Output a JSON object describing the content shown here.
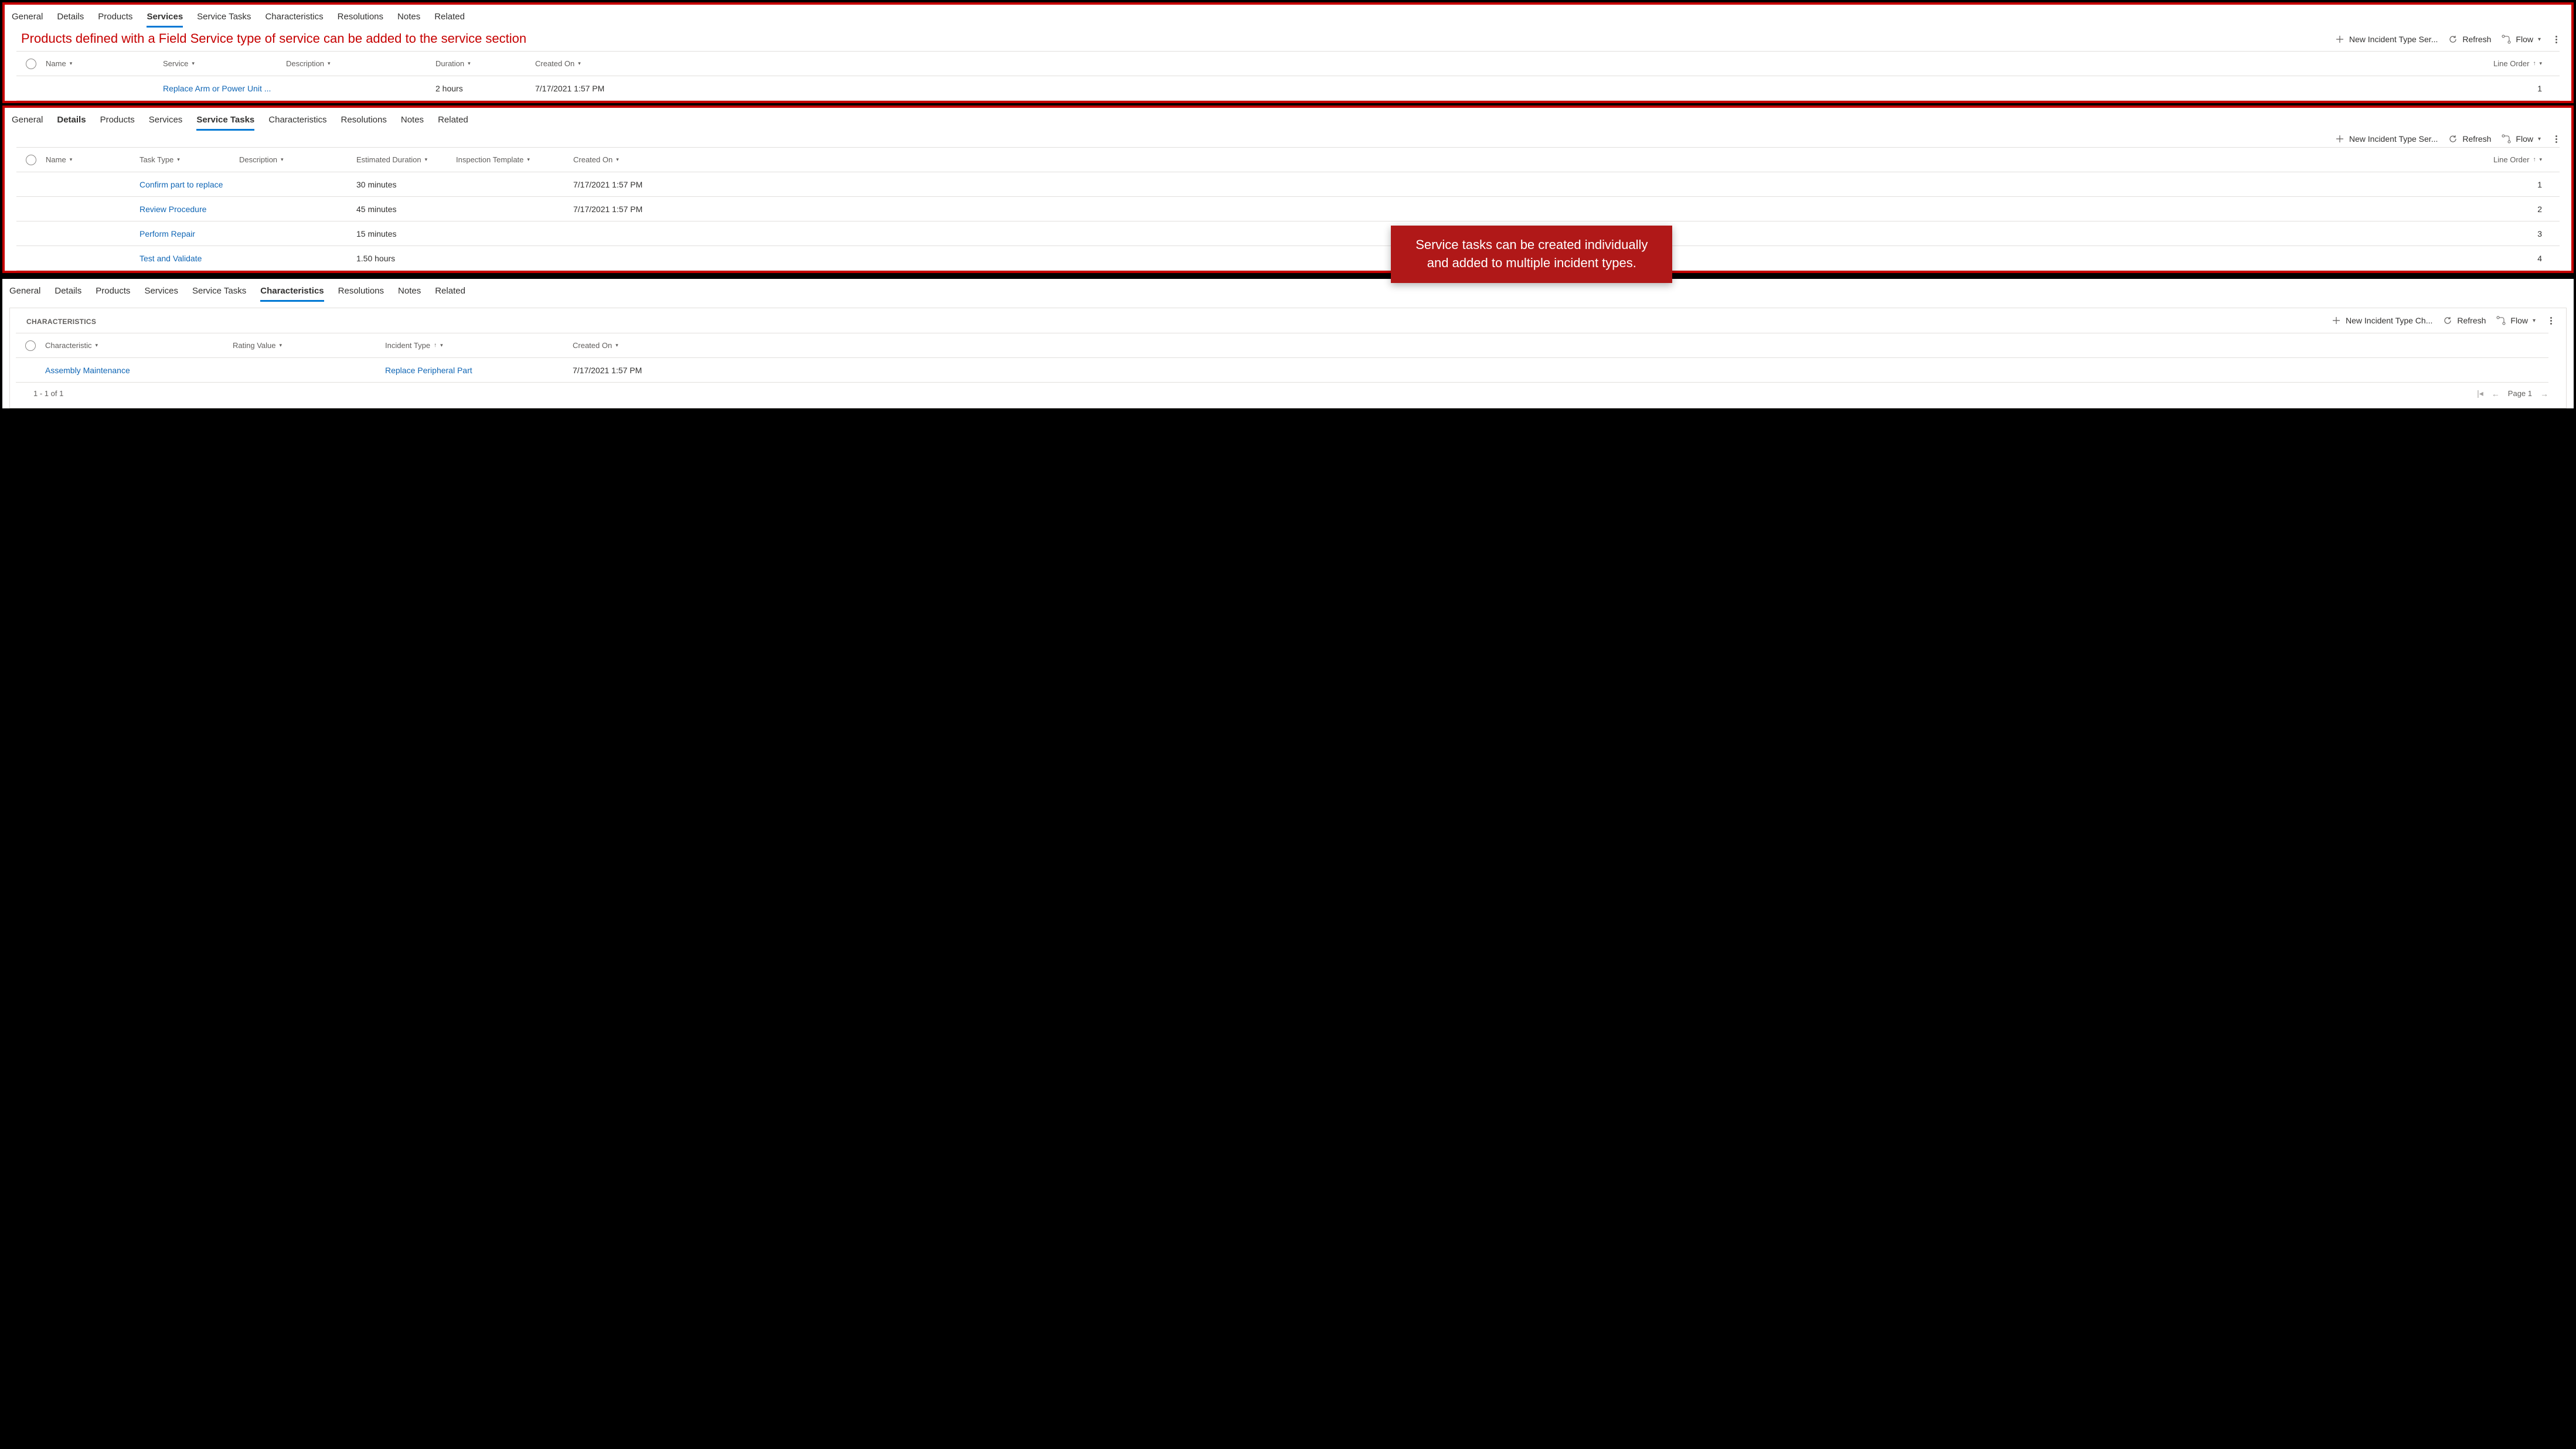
{
  "tabs": [
    "General",
    "Details",
    "Products",
    "Services",
    "Service Tasks",
    "Characteristics",
    "Resolutions",
    "Notes",
    "Related"
  ],
  "panel1": {
    "activeTab": "Services",
    "caption": "Products defined with a Field Service type of service can be added to the service section",
    "toolbar": {
      "newLabel": "New Incident Type Ser...",
      "refresh": "Refresh",
      "flow": "Flow"
    },
    "columns": {
      "name": "Name",
      "service": "Service",
      "description": "Description",
      "duration": "Duration",
      "createdOn": "Created On",
      "lineOrder": "Line Order"
    },
    "rows": [
      {
        "name": "",
        "service": "Replace Arm or Power Unit ...",
        "description": "",
        "duration": "2 hours",
        "createdOn": "7/17/2021 1:57 PM",
        "lineOrder": "1"
      }
    ]
  },
  "panel2": {
    "activeTab": "Service Tasks",
    "boldTab": "Details",
    "toolbar": {
      "newLabel": "New Incident Type Ser...",
      "refresh": "Refresh",
      "flow": "Flow"
    },
    "columns": {
      "name": "Name",
      "taskType": "Task Type",
      "description": "Description",
      "estDuration": "Estimated Duration",
      "inspection": "Inspection Template",
      "createdOn": "Created On",
      "lineOrder": "Line Order"
    },
    "rows": [
      {
        "taskType": "Confirm part to replace",
        "estDuration": "30 minutes",
        "createdOn": "7/17/2021 1:57 PM",
        "lineOrder": "1"
      },
      {
        "taskType": "Review Procedure",
        "estDuration": "45 minutes",
        "createdOn": "7/17/2021 1:57 PM",
        "lineOrder": "2"
      },
      {
        "taskType": "Perform Repair",
        "estDuration": "15 minutes",
        "createdOn": "",
        "lineOrder": "3"
      },
      {
        "taskType": "Test and Validate",
        "estDuration": "1.50 hours",
        "createdOn": "",
        "lineOrder": "4"
      }
    ],
    "callout": "Service tasks can be created individually and added to multiple incident types."
  },
  "panel3": {
    "activeTab": "Characteristics",
    "sectionLabel": "CHARACTERISTICS",
    "toolbar": {
      "newLabel": "New Incident Type Ch...",
      "refresh": "Refresh",
      "flow": "Flow"
    },
    "columns": {
      "characteristic": "Characteristic",
      "rating": "Rating Value",
      "incidentType": "Incident Type",
      "createdOn": "Created On"
    },
    "rows": [
      {
        "characteristic": "Assembly Maintenance",
        "rating": "",
        "incidentType": "Replace Peripheral Part",
        "createdOn": "7/17/2021 1:57 PM"
      }
    ],
    "pager": {
      "range": "1 - 1 of 1",
      "page": "Page 1"
    }
  }
}
